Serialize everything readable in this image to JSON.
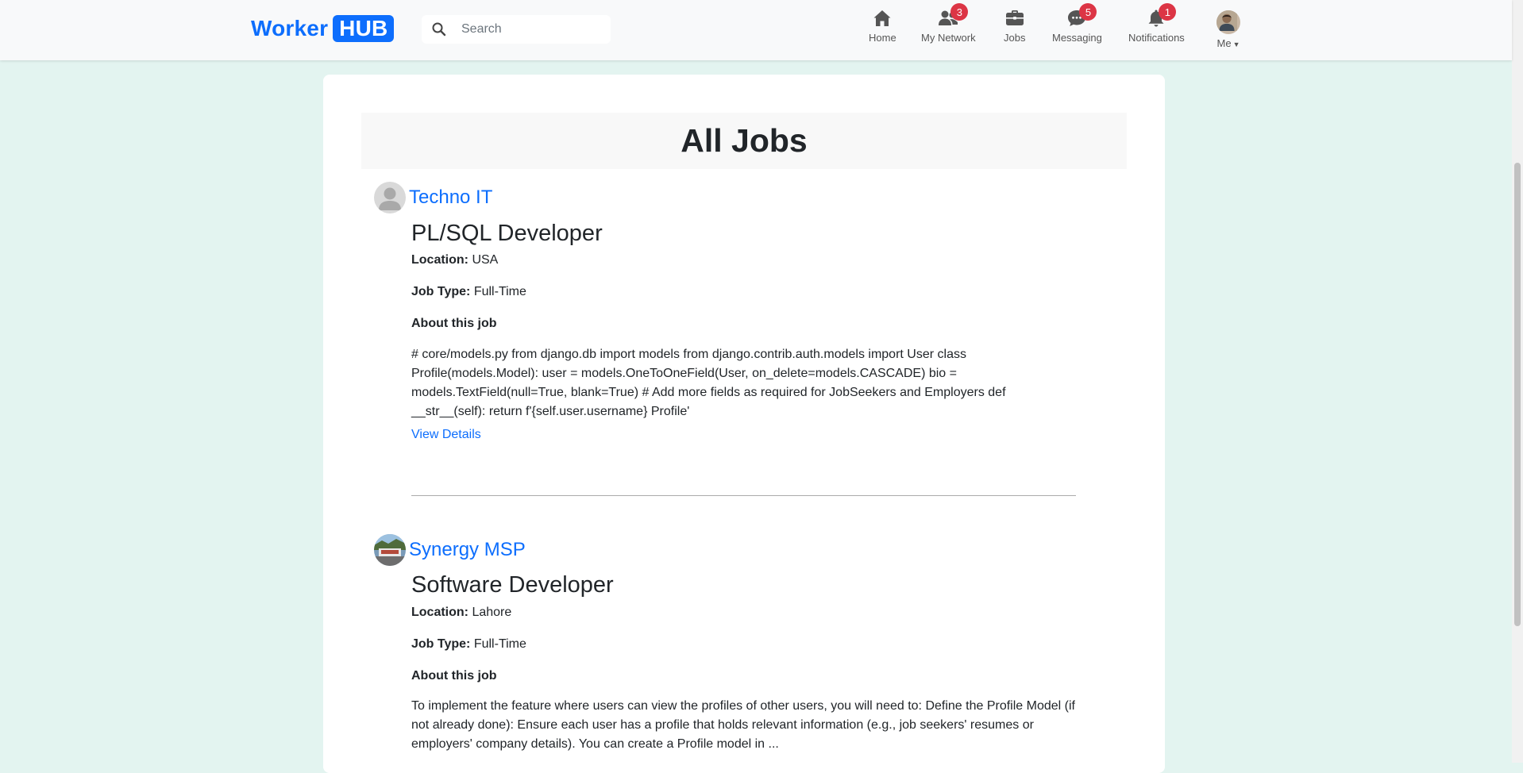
{
  "brand": {
    "word": "Worker",
    "box": "HUB",
    "color": "#0d6efd"
  },
  "search": {
    "placeholder": "Search"
  },
  "nav": {
    "home": {
      "label": "Home"
    },
    "network": {
      "label": "My Network",
      "badge": "3"
    },
    "jobs": {
      "label": "Jobs"
    },
    "messaging": {
      "label": "Messaging",
      "badge": "5"
    },
    "notifications": {
      "label": "Notifications",
      "badge": "1"
    },
    "me": {
      "label": "Me"
    }
  },
  "page": {
    "title": "All Jobs"
  },
  "labels": {
    "location": "Location:",
    "job_type": "Job Type:",
    "about": "About this job",
    "view_details": "View Details"
  },
  "jobs": [
    {
      "company": "Techno IT",
      "title": "PL/SQL Developer",
      "location": "USA",
      "job_type": "Full-Time",
      "description": "# core/models.py from django.db import models from django.contrib.auth.models import User class Profile(models.Model): user = models.OneToOneField(User, on_delete=models.CASCADE) bio = models.TextField(null=True, blank=True) # Add more fields as required for JobSeekers and Employers def __str__(self): return f'{self.user.username} Profile'"
    },
    {
      "company": "Synergy MSP",
      "title": "Software Developer",
      "location": "Lahore",
      "job_type": "Full-Time",
      "description": "To implement the feature where users can view the profiles of other users, you will need to: Define the Profile Model (if not already done): Ensure each user has a profile that holds relevant information (e.g., job seekers' resumes or employers' company details). You can create a Profile model in ..."
    }
  ],
  "colors": {
    "accent": "#0d6efd",
    "badge": "#dc3545",
    "background": "#e3f4f0"
  },
  "icons": [
    "search-icon",
    "home-icon",
    "network-icon",
    "briefcase-icon",
    "messaging-icon",
    "bell-icon",
    "caret-down-icon"
  ]
}
